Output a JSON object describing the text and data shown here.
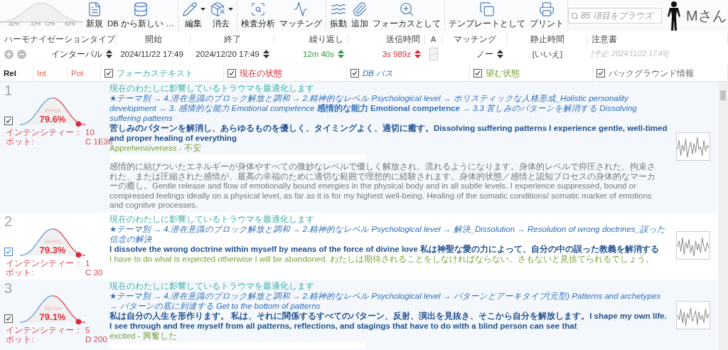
{
  "toolbar": {
    "bell_labels": [
      "-62%",
      "-12%",
      "12%",
      "62%"
    ],
    "groups": [
      {
        "buttons": [
          {
            "label": "新規",
            "kind": "button"
          },
          {
            "label": "DB から新しい …",
            "kind": "button"
          }
        ]
      },
      {
        "buttons": [
          {
            "label": "編集",
            "kind": "dropdown"
          },
          {
            "label": "消去",
            "kind": "dropdown"
          }
        ]
      },
      {
        "buttons": [
          {
            "label": "検査分析",
            "kind": "button"
          },
          {
            "label": "マッチング",
            "kind": "button"
          }
        ]
      },
      {
        "buttons": [
          {
            "label": "振動",
            "kind": "button"
          },
          {
            "label": "追加",
            "kind": "button"
          },
          {
            "label": "フォーカスとして",
            "kind": "button"
          }
        ]
      },
      {
        "buttons": [
          {
            "label": "テンプレートとして",
            "kind": "button"
          },
          {
            "label": "プリント",
            "kind": "button"
          }
        ]
      }
    ],
    "search": {
      "placeholder": "85 項目をブラウズ"
    },
    "user": {
      "name": "Mさん"
    }
  },
  "settings": {
    "labels": [
      "ハーモナイゼーションタイプ",
      "開始",
      "終了",
      "繰り返し",
      "送信時間",
      "A",
      "マッチング",
      "静止時間",
      "注意書"
    ],
    "values": [
      {
        "kind": "type-picker",
        "value": "インターバル",
        "color": "#333333"
      },
      {
        "kind": "spinner",
        "value": "2024/11/22 17:49",
        "color": "#333333"
      },
      {
        "kind": "spinner",
        "value": "2024/12/20 17:49",
        "color": "#333333"
      },
      {
        "kind": "spinner",
        "value": "12m 40s",
        "color": "#2e9a3e"
      },
      {
        "kind": "spinner",
        "value": "3s 989z",
        "color": "#d8282f"
      },
      {
        "kind": "sparkline"
      },
      {
        "kind": "spinner",
        "value": "ノー",
        "color": "#333333"
      },
      {
        "kind": "text",
        "value": "[いいえ]"
      },
      {
        "kind": "note",
        "value": "[予定: 2024/11/22 17:49]"
      }
    ]
  },
  "columns": [
    {
      "label": "Rel",
      "kind": "rel"
    },
    {
      "label": "Int",
      "kind": "int"
    },
    {
      "label": "Pot",
      "kind": "pot"
    },
    {
      "label": "フォーカステキスト",
      "kind": "focus",
      "checked": true
    },
    {
      "label": "現在の状態",
      "kind": "current",
      "checked": true
    },
    {
      "label": "DB パス",
      "kind": "path",
      "checked": true
    },
    {
      "label": "望む状態",
      "kind": "desired",
      "checked": true
    },
    {
      "label": "バックグラウンド情報",
      "kind": "background",
      "checked": true
    }
  ],
  "rows": [
    {
      "number": "1",
      "checked": true,
      "selected": false,
      "percent": "79.6%",
      "gauge_label": "En+Cn",
      "intensity_label": "インテンシティー：",
      "intensity": "10",
      "pot_label": "ポット:",
      "pot": "C 1E36",
      "focus": "現在のわたしに影響しているトラウマを最適化します",
      "path": "★テーマ別 → 4.潜在意識のブロック解放と調和 → 2.精神的なレベル Psychological level → ホリスティックな人格形成_Holistic personality development → 3. 感情的な能力 Emotional competence **感情的な能力 Emotional competence** → 3.3 苦しみのパターンを解消する Dissolving suffering patterns",
      "statement": "苦しみのパターンを解消し、あらゆるものを優しく、タイミングよく、適切に癒す。Dissolving suffering patterns I experience gentle, well-timed and proper healing of everything",
      "desired": "Apprehensiveness - 不安",
      "background": "感情的に結びついたエネルギーが身体やすべての微妙なレベルで優しく解放され、流れるようになります。身体的レベルで抑圧された、拘束された、または圧縮された感情が、最高の幸福のために適切な範囲で理想的に経験されます。身体的状態／感情と認知プロセスの身体的なマーカーの癒し。Gentle release and flow of emotionally bound energies in the physical body and in all subtle levels. I experience suppressed, bound or compressed feelings ideally on a physical level, as far as it is for my highest well-being. Healing of the somatic conditions/ somatic marker of emotions and cognitve processes."
    },
    {
      "number": "2",
      "checked": true,
      "selected": true,
      "percent": "79.3%",
      "gauge_label": "En+Cn",
      "intensity_label": "インテンシティー：",
      "intensity": "1",
      "pot_label": "ポット:",
      "pot": "C 30",
      "focus": "現在のわたしに影響しているトラウマを最適化します",
      "path": "★テーマ別 → 4.潜在意識のブロック解放と調和 → 2.精神的なレベル Psychological level → 解決_Dissolution → Resolution of wrong doctrines_誤った信念の解決",
      "statement": "I dissolve the wrong doctrine within myself by means of the force of divine love 私は神聖な愛の力によって、自分の中の誤った教義を解消する",
      "desired": "I have to do what is expected otherwise I will be abandoned. わたしは期待されることをしなければならない、さもないと見捨てられるでしょう。"
    },
    {
      "number": "3",
      "checked": true,
      "selected": false,
      "percent": "79.1%",
      "gauge_label": "En+Cn",
      "intensity_label": "インテンシティー：",
      "intensity": "5",
      "pot_label": "ポット:",
      "pot": "D 200",
      "focus": "現在のわたしに影響しているトラウマを最適化します",
      "path": "★テーマ別 → 4.潜在意識のブロック解放と調和 → 2.精神的なレベル Psychological level → パターンとアーキタイプ(元型) Patterns and archetypes → パターンの底に到達する Get to the bottom of patterns",
      "statement": "私は自分の人生を形作ります。 私は、それに関係するすべてのパターン、反射、演出を見抜き、そこから自分を解放します。I shape my own life. I see through and free myself from all patterns, reflections, and stagings that have to do with a blind person can see that",
      "desired": "excited - 興奮した"
    }
  ]
}
